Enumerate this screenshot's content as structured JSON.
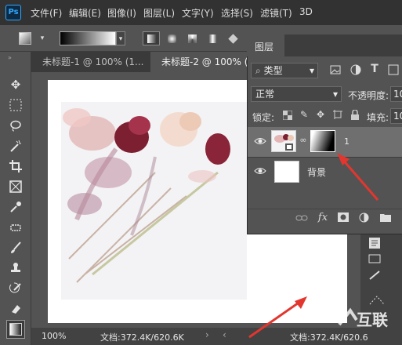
{
  "app": {
    "logo": "Ps"
  },
  "menu": [
    "文件(F)",
    "编辑(E)",
    "图像(I)",
    "图层(L)",
    "文字(Y)",
    "选择(S)",
    "滤镜(T)",
    "3D"
  ],
  "tabs": [
    {
      "label": "未标题-1 @ 100% (1...",
      "active": false
    },
    {
      "label": "未标题-2 @ 100% (1...",
      "active": true
    }
  ],
  "layers_panel": {
    "title": "图层",
    "filter_kind": "类型",
    "blend_mode": "正常",
    "opacity_label": "不透明度:",
    "opacity_value": "10",
    "lock_label": "锁定:",
    "fill_label": "填充:",
    "fill_value": "10",
    "layers": [
      {
        "name": "1",
        "selected": true,
        "has_mask": true
      },
      {
        "name": "背景",
        "selected": false,
        "has_mask": false
      }
    ]
  },
  "status": {
    "zoom": "100%",
    "doc_info": "文档:372.4K/620.6K",
    "doc_info_right": "文档:372.4K/620.6"
  },
  "watermark": "互联",
  "colors": {
    "accent_blue": "#31a8ff",
    "arrow_red": "#e2362f",
    "panel_bg": "#535353",
    "menubar_bg": "#323232"
  },
  "icons": {
    "tools": [
      "move-icon",
      "marquee-icon",
      "lasso-icon",
      "magic-wand-icon",
      "crop-icon",
      "frame-icon",
      "eyedropper-icon",
      "spot-healing-icon",
      "brush-icon",
      "stamp-icon",
      "history-brush-icon",
      "eraser-icon",
      "gradient-icon"
    ]
  }
}
